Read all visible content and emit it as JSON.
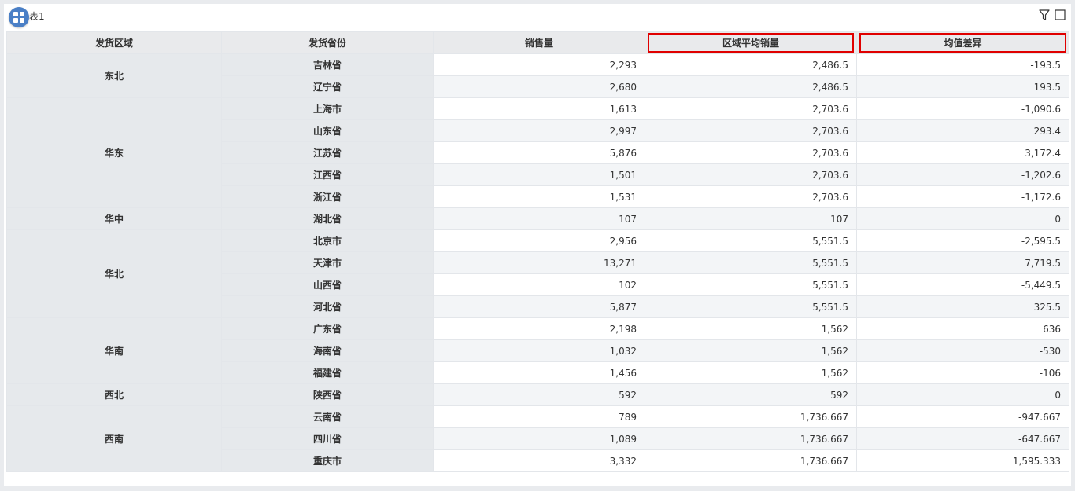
{
  "panel": {
    "title": "表1"
  },
  "icons": {
    "app": "grid-icon",
    "filter": "filter-icon",
    "maximize": "maximize-icon"
  },
  "colors": {
    "highlight_border": "#e00000",
    "badge": "#4a7fc6"
  },
  "table": {
    "headers": [
      "发货区域",
      "发货省份",
      "销售量",
      "区域平均销量",
      "均值差异"
    ],
    "highlighted_headers": [
      "区域平均销量",
      "均值差异"
    ],
    "groups": [
      {
        "region": "东北",
        "rows": [
          {
            "province": "吉林省",
            "sales": "2,293",
            "avg": "2,486.5",
            "diff": "-193.5"
          },
          {
            "province": "辽宁省",
            "sales": "2,680",
            "avg": "2,486.5",
            "diff": "193.5"
          }
        ]
      },
      {
        "region": "华东",
        "rows": [
          {
            "province": "上海市",
            "sales": "1,613",
            "avg": "2,703.6",
            "diff": "-1,090.6"
          },
          {
            "province": "山东省",
            "sales": "2,997",
            "avg": "2,703.6",
            "diff": "293.4"
          },
          {
            "province": "江苏省",
            "sales": "5,876",
            "avg": "2,703.6",
            "diff": "3,172.4"
          },
          {
            "province": "江西省",
            "sales": "1,501",
            "avg": "2,703.6",
            "diff": "-1,202.6"
          },
          {
            "province": "浙江省",
            "sales": "1,531",
            "avg": "2,703.6",
            "diff": "-1,172.6"
          }
        ]
      },
      {
        "region": "华中",
        "rows": [
          {
            "province": "湖北省",
            "sales": "107",
            "avg": "107",
            "diff": "0"
          }
        ]
      },
      {
        "region": "华北",
        "rows": [
          {
            "province": "北京市",
            "sales": "2,956",
            "avg": "5,551.5",
            "diff": "-2,595.5"
          },
          {
            "province": "天津市",
            "sales": "13,271",
            "avg": "5,551.5",
            "diff": "7,719.5"
          },
          {
            "province": "山西省",
            "sales": "102",
            "avg": "5,551.5",
            "diff": "-5,449.5"
          },
          {
            "province": "河北省",
            "sales": "5,877",
            "avg": "5,551.5",
            "diff": "325.5"
          }
        ]
      },
      {
        "region": "华南",
        "rows": [
          {
            "province": "广东省",
            "sales": "2,198",
            "avg": "1,562",
            "diff": "636"
          },
          {
            "province": "海南省",
            "sales": "1,032",
            "avg": "1,562",
            "diff": "-530"
          },
          {
            "province": "福建省",
            "sales": "1,456",
            "avg": "1,562",
            "diff": "-106"
          }
        ]
      },
      {
        "region": "西北",
        "rows": [
          {
            "province": "陕西省",
            "sales": "592",
            "avg": "592",
            "diff": "0"
          }
        ]
      },
      {
        "region": "西南",
        "rows": [
          {
            "province": "云南省",
            "sales": "789",
            "avg": "1,736.667",
            "diff": "-947.667"
          },
          {
            "province": "四川省",
            "sales": "1,089",
            "avg": "1,736.667",
            "diff": "-647.667"
          },
          {
            "province": "重庆市",
            "sales": "3,332",
            "avg": "1,736.667",
            "diff": "1,595.333"
          }
        ]
      }
    ]
  }
}
